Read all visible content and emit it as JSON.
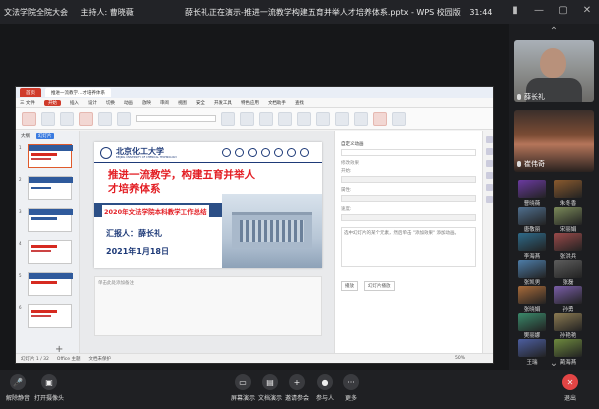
{
  "top": {
    "meeting": "文法学院全院大会",
    "host": "主持人: 曹晓薇",
    "center": "薛长礼正在演示-推进一流教学构建五育并举人才培养体系.pptx - WPS 校园版",
    "time": "31:44"
  },
  "wps": {
    "tabs": [
      "首页",
      "推进一流教学…才培养体系"
    ],
    "menu": [
      "三 文件",
      "开始",
      "插入",
      "设计",
      "切换",
      "动画",
      "放映",
      "审阅",
      "视图",
      "安全",
      "开发工具",
      "特色应用",
      "文档助手",
      "查找"
    ],
    "active_menu": "开始",
    "thumb_tabs": [
      "大纲",
      "幻灯片"
    ],
    "thumb_numbers": [
      "1",
      "2",
      "3",
      "4",
      "5",
      "6"
    ],
    "notes_placeholder": "单击此处添加备注",
    "panel_title": "自定义动画",
    "panel_fields": [
      "修改效果",
      "开始:",
      "属性:",
      "速度:"
    ],
    "panel_hint": "选中幻灯片的某个元素，然后单击 \"添加效果\" 添加动画。",
    "panel_buttons": [
      "播放",
      "幻灯片播放"
    ],
    "status": [
      "幻灯片 1 / 32",
      "Office 主题",
      "文档未保护"
    ],
    "zoom": "50%"
  },
  "slide": {
    "university": "北京化工大学",
    "university_en": "BEIJING UNIVERSITY OF CHEMICAL TECHNOLOGY",
    "headline": "推进一流教学，构建五育并举人才培养体系",
    "subtitle": "2020年文法学院本科教学工作总结",
    "reporter": "汇报人：薛长礼",
    "date": "2021年1月18日"
  },
  "participants": {
    "video": [
      {
        "name": "薛长礼"
      },
      {
        "name": "崔伟奇"
      }
    ],
    "avatars": [
      {
        "name": "曹晓薇",
        "color": "#6b3aa0"
      },
      {
        "name": "朱冬香",
        "color": "#8a5a2e"
      },
      {
        "name": "唐敬丽",
        "color": "#4f6f8e"
      },
      {
        "name": "宋丽娟",
        "color": "#7b8a5a"
      },
      {
        "name": "李海燕",
        "color": "#2e6b8a"
      },
      {
        "name": "张洪兵",
        "color": "#9a4a4a"
      },
      {
        "name": "张凯男",
        "color": "#4d7da8"
      },
      {
        "name": "张磊",
        "color": "#5d5d5d"
      },
      {
        "name": "张晓娟",
        "color": "#a86b3a"
      },
      {
        "name": "孙勇",
        "color": "#7a5ea8"
      },
      {
        "name": "樊丽娜",
        "color": "#3a8a6b"
      },
      {
        "name": "孙艳艳",
        "color": "#8c7b52"
      },
      {
        "name": "王瑞",
        "color": "#4c5ea0"
      },
      {
        "name": "蔺海燕",
        "color": "#6e8a3e"
      }
    ]
  },
  "bottom": {
    "mute": "解除静音",
    "camera": "打开摄像头",
    "share": "屏幕演示",
    "docs": "文档演示",
    "invite": "邀请参会",
    "members": "参与人",
    "more": "更多",
    "leave": "退出"
  }
}
